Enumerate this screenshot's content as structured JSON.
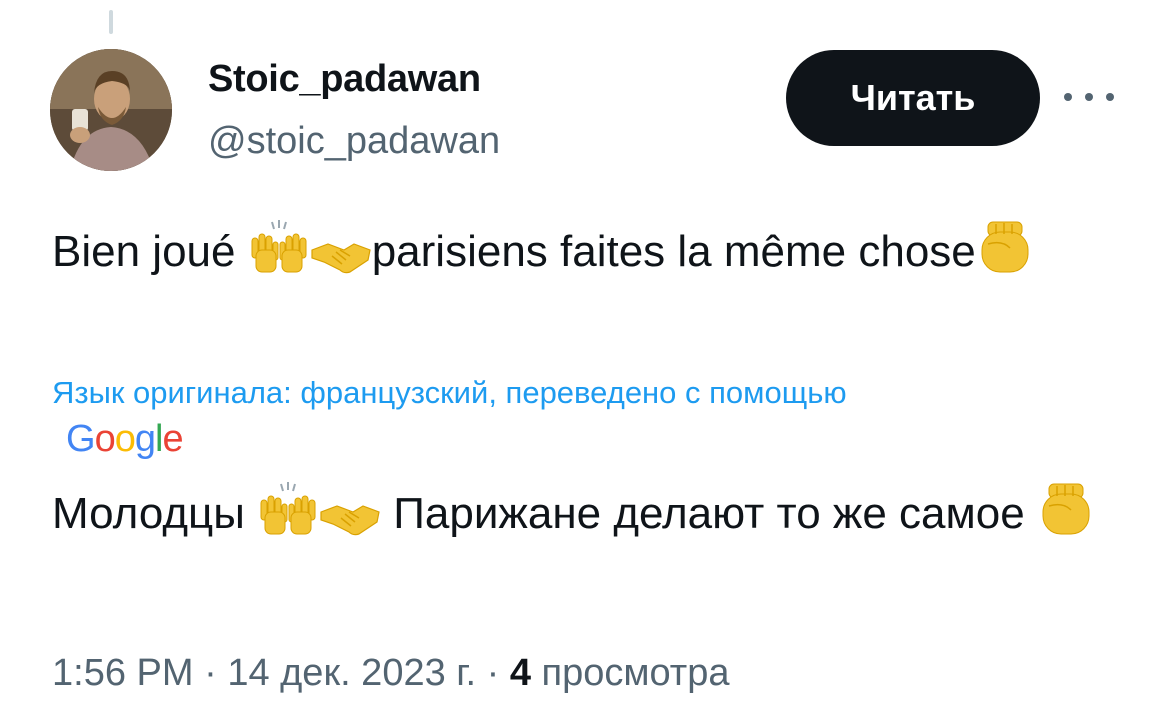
{
  "author": {
    "display_name": "Stoic_padawan",
    "handle": "@stoic_padawan"
  },
  "follow_button": {
    "label": "Читать"
  },
  "tweet": {
    "text_part1": "Bien joué ",
    "text_part2": "parisiens faites la même chose",
    "translation_note": "Язык оригинала: французский, переведено с помощью",
    "translation_provider": "Google",
    "translated_part1": "Молодцы ",
    "translated_part2": " Парижане делают то же самое "
  },
  "meta": {
    "time": "1:56 PM",
    "separator": " · ",
    "date": "14 дек. 2023 г.",
    "views_count": "4",
    "views_label": " просмотра"
  },
  "icons": {
    "raising_hands": "raising-hands-emoji",
    "handshake": "handshake-emoji",
    "raised_fist": "raised-fist-emoji",
    "more": "more-dots-icon"
  },
  "colors": {
    "text_primary": "#0f1419",
    "text_secondary": "#536471",
    "link": "#1d9bf0",
    "button_bg": "#0f1419"
  }
}
